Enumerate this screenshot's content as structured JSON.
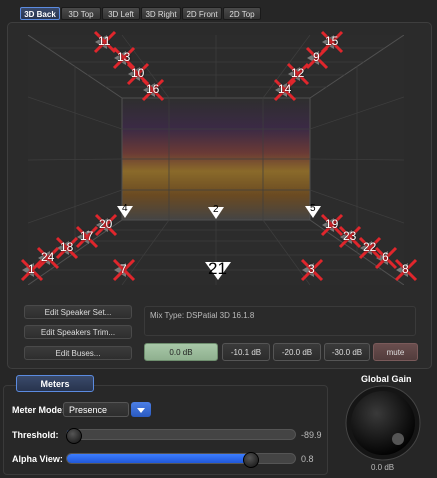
{
  "tabs": [
    {
      "label": "3D Back",
      "active": true
    },
    {
      "label": "3D Top",
      "active": false
    },
    {
      "label": "3D Left",
      "active": false
    },
    {
      "label": "3D Right",
      "active": false
    },
    {
      "label": "2D Front",
      "active": false
    },
    {
      "label": "2D Top",
      "active": false
    }
  ],
  "speakers": [
    "1",
    "2",
    "3",
    "4",
    "5",
    "6",
    "7",
    "8",
    "9",
    "10",
    "11",
    "12",
    "13",
    "14",
    "15",
    "16",
    "17",
    "18",
    "19",
    "20",
    "21",
    "22",
    "23",
    "24"
  ],
  "buttons": {
    "edit_speaker_set": "Edit Speaker Set...",
    "edit_speakers_trim": "Edit Speakers Trim...",
    "edit_buses": "Edit Buses..."
  },
  "mix_type": "Mix Type: DSPatial 3D 16.1.8",
  "db_buttons": [
    "0.0 dB",
    "-10.1 dB",
    "-20.0 dB",
    "-30.0 dB",
    "mute"
  ],
  "meters": {
    "tab_label": "Meters",
    "mode_label": "Meter Mode:",
    "mode_value": "Presence",
    "threshold_label": "Threshold:",
    "threshold_value": "-89.9",
    "threshold_level": 0.02,
    "alpha_label": "Alpha View:",
    "alpha_value": "0.8",
    "alpha_level": 0.8
  },
  "global_gain": {
    "label": "Global Gain",
    "value": "0.0 dB"
  },
  "colors": {
    "accent": "#3c7dff",
    "speaker_cross": "#e0262c",
    "active_db": "#9dbd9d"
  }
}
